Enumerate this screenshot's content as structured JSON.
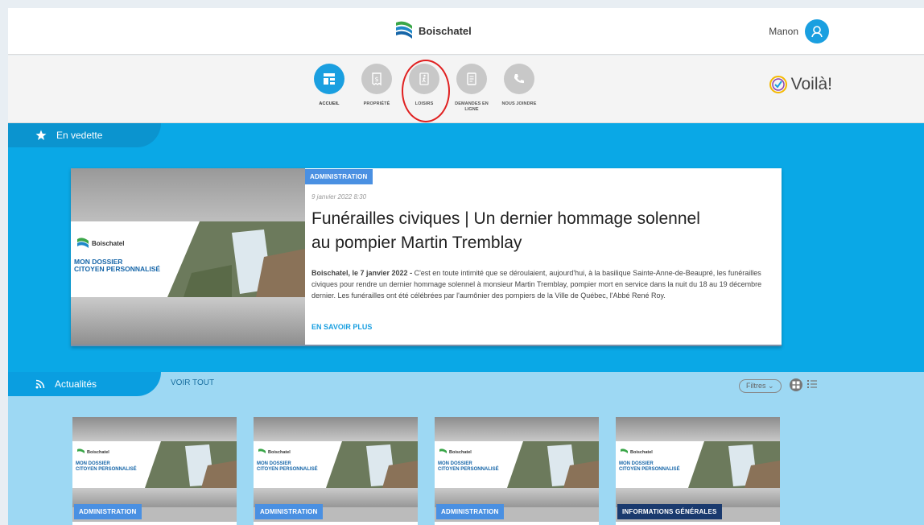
{
  "header": {
    "brand": "Boischatel",
    "user_name": "Manon"
  },
  "nav": {
    "items": [
      {
        "label": "ACCUEIL",
        "icon": "home-grid-icon",
        "active": true
      },
      {
        "label": "PROPRIÉTÉ",
        "icon": "tax-bill-icon",
        "active": false
      },
      {
        "label": "LOISIRS",
        "icon": "activity-figure-icon",
        "active": false
      },
      {
        "label": "DEMANDES EN LIGNE",
        "icon": "document-icon",
        "active": false
      },
      {
        "label": "NOUS JOINDRE",
        "icon": "phone-icon",
        "active": false
      }
    ],
    "voila_text": "Voilà!"
  },
  "featured": {
    "section_label": "En vedette",
    "card": {
      "image_brand": "Boischatel",
      "image_caption": "MON DOSSIER CITOYEN PERSONNALISÉ",
      "category": "ADMINISTRATION",
      "date": "9 janvier 2022 8:30",
      "title": "Funérailles civiques | Un dernier hommage solennel au pompier Martin Tremblay",
      "text_lead": "Boischatel, le 7 janvier 2022 - ",
      "text_body": "C'est en toute intimité que se déroulaient, aujourd'hui, à la basilique Sainte-Anne-de-Beaupré, les funérailles civiques pour rendre un dernier hommage solennel à monsieur Martin Tremblay, pompier mort en service dans la nuit du 18 au 19 décembre dernier. Les funérailles ont été célébrées par l'aumônier des pompiers de la Ville de Québec, l'Abbé René Roy.",
      "more_link": "EN SAVOIR PLUS"
    }
  },
  "news": {
    "section_label": "Actualités",
    "see_all": "VOIR TOUT",
    "filters_label": "Filtres ⌄",
    "cards": [
      {
        "category": "ADMINISTRATION",
        "brand": "Boischatel",
        "caption": "MON DOSSIER CITOYEN PERSONNALISÉ"
      },
      {
        "category": "ADMINISTRATION",
        "brand": "Boischatel",
        "caption": "MON DOSSIER CITOYEN PERSONNALISÉ"
      },
      {
        "category": "ADMINISTRATION",
        "brand": "Boischatel",
        "caption": "MON DOSSIER CITOYEN PERSONNALISÉ"
      },
      {
        "category": "INFORMATIONS GÉNÉRALES",
        "brand": "Boischatel",
        "caption": "MON DOSSIER CITOYEN PERSONNALISÉ"
      }
    ]
  },
  "colors": {
    "accent_blue": "#1a9fe0",
    "featured_bg": "#0aa8e6",
    "news_bg": "#9dd8f3",
    "badge_blue": "#4a90e2",
    "highlight_red": "#e02020"
  }
}
